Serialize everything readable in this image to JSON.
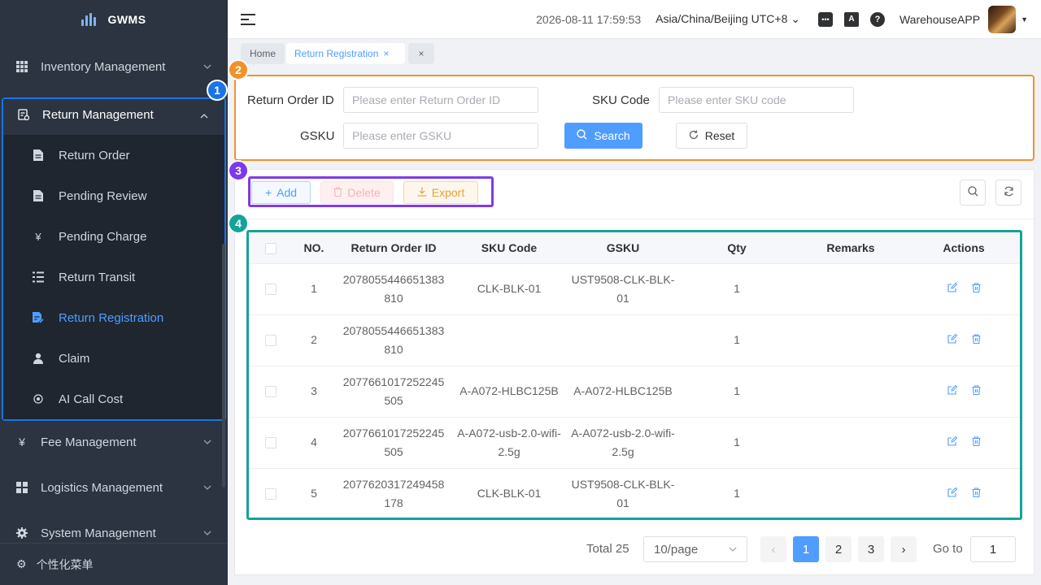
{
  "app": {
    "name": "GWMS"
  },
  "sidebar": {
    "items": [
      {
        "label": "Inventory Management",
        "icon": "grid-icon"
      },
      {
        "label": "Return Management",
        "icon": "return-icon"
      },
      {
        "label": "Fee Management",
        "icon": "yen-icon"
      },
      {
        "label": "Logistics Management",
        "icon": "blocks-icon"
      },
      {
        "label": "System Management",
        "icon": "gear-icon"
      }
    ],
    "sub_items": [
      {
        "label": "Return Order",
        "icon": "document-icon"
      },
      {
        "label": "Pending Review",
        "icon": "document-icon"
      },
      {
        "label": "Pending Charge",
        "icon": "yen-icon"
      },
      {
        "label": "Return Transit",
        "icon": "list-icon"
      },
      {
        "label": "Return Registration",
        "icon": "register-icon"
      },
      {
        "label": "Claim",
        "icon": "user-icon"
      },
      {
        "label": "AI Call Cost",
        "icon": "coin-icon"
      }
    ],
    "active_sub": "Return Registration",
    "footer_label": "个性化菜单"
  },
  "header": {
    "datetime": "2026-08-11 17:59:53",
    "timezone": "Asia/China/Beijing UTC+8",
    "username": "WarehouseAPP"
  },
  "tags": {
    "home": "Home",
    "active": "Return Registration"
  },
  "search": {
    "return_order_label": "Return Order ID",
    "return_order_placeholder": "Please enter Return Order ID",
    "sku_label": "SKU Code",
    "sku_placeholder": "Please enter SKU code",
    "gsku_label": "GSKU",
    "gsku_placeholder": "Please enter GSKU",
    "search_btn": "Search",
    "reset_btn": "Reset"
  },
  "toolbar": {
    "add": "Add",
    "delete": "Delete",
    "export": "Export"
  },
  "table": {
    "columns": [
      "NO.",
      "Return Order ID",
      "SKU Code",
      "GSKU",
      "Qty",
      "Remarks",
      "Actions"
    ],
    "rows": [
      {
        "no": "1",
        "order_id": "2078055446651383810",
        "sku": "CLK-BLK-01",
        "gsku": "UST9508-CLK-BLK-01",
        "qty": "1",
        "remarks": ""
      },
      {
        "no": "2",
        "order_id": "2078055446651383810",
        "sku": "",
        "gsku": "",
        "qty": "1",
        "remarks": ""
      },
      {
        "no": "3",
        "order_id": "2077661017252245505",
        "sku": "A-A072-HLBC125B",
        "gsku": "A-A072-HLBC125B",
        "qty": "1",
        "remarks": ""
      },
      {
        "no": "4",
        "order_id": "2077661017252245505",
        "sku": "A-A072-usb-2.0-wifi-2.5g",
        "gsku": "A-A072-usb-2.0-wifi-2.5g",
        "qty": "1",
        "remarks": ""
      },
      {
        "no": "5",
        "order_id": "2077620317249458178",
        "sku": "CLK-BLK-01",
        "gsku": "UST9508-CLK-BLK-01",
        "qty": "1",
        "remarks": ""
      }
    ]
  },
  "pagination": {
    "total": "Total 25",
    "page_size": "10/page",
    "pages": [
      "1",
      "2",
      "3"
    ],
    "current": "1",
    "goto_label": "Go to",
    "goto_value": "1"
  },
  "badges": [
    "1",
    "2",
    "3",
    "4"
  ],
  "colors": {
    "accent": "#4f9dff",
    "badge_1": "#1a73e8",
    "badge_2": "#f0922b",
    "badge_3": "#7c3aed",
    "badge_4": "#14a39a"
  }
}
